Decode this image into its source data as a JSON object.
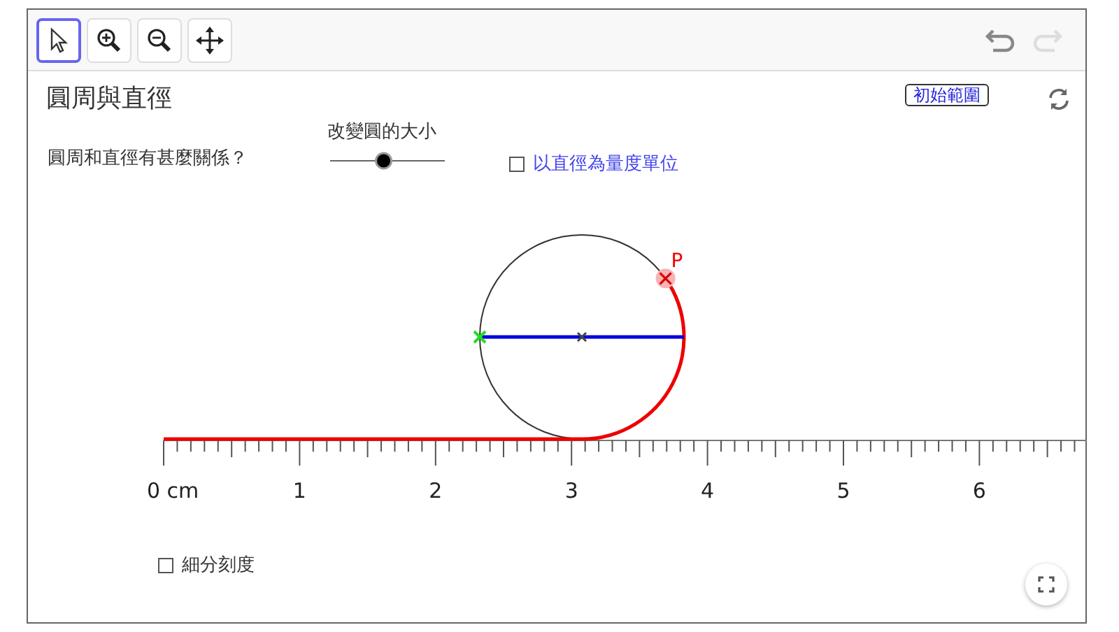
{
  "toolbar": {
    "tools": [
      {
        "kind": "select",
        "selected": true
      },
      {
        "kind": "zoom-in",
        "selected": false
      },
      {
        "kind": "zoom-out",
        "selected": false
      },
      {
        "kind": "move",
        "selected": false
      }
    ],
    "undo": {
      "disabled": false
    },
    "redo": {
      "disabled": true
    }
  },
  "canvas": {
    "title": "圓周與直徑",
    "question": "圓周和直徑有甚麼關係？",
    "slider": {
      "label": "改變圓的大小",
      "level": 0.46
    },
    "diameter_unit": {
      "label": "以直徑為量度單位",
      "checked": false
    },
    "reset_button": "初始範圍",
    "point_label": "P",
    "ruler": {
      "labels": [
        "0 cm",
        "1",
        "2",
        "3",
        "4",
        "5",
        "6"
      ]
    },
    "fine_ticks": {
      "label": "細分刻度",
      "checked": false
    }
  }
}
